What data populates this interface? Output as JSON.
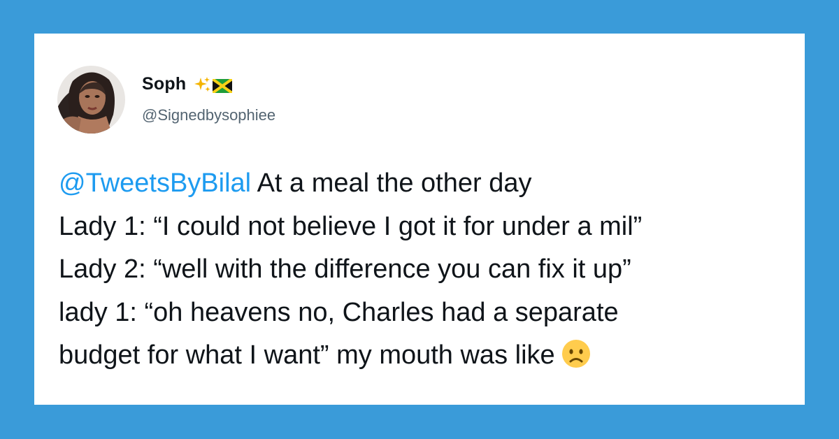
{
  "tweet": {
    "author": {
      "display_name": "Soph",
      "handle": "@Signedbysophiee",
      "name_emojis": [
        "sparkles-icon",
        "jamaica-flag-icon"
      ]
    },
    "mention": "@TweetsByBilal",
    "lines": [
      " At a meal the other day",
      "Lady 1: “I could not believe I got it for under a mil”",
      "Lady 2: “well with the difference you can fix it up”",
      "lady 1: “oh heavens no, Charles had a separate",
      "budget for what I want” my mouth was like"
    ],
    "trailing_emoji": "frowning-face-icon"
  },
  "colors": {
    "background": "#3a9bd9",
    "card": "#ffffff",
    "text": "#0f1419",
    "mention": "#1d9bf0",
    "handle": "#536471"
  }
}
